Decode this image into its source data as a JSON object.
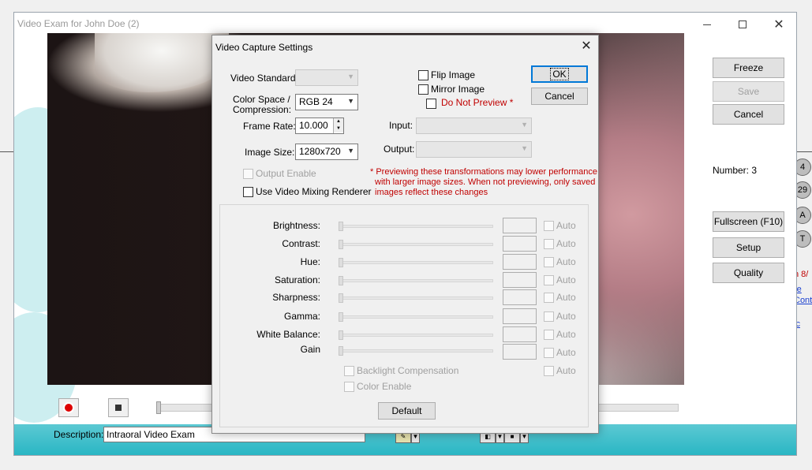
{
  "main_window": {
    "title": "Video Exam for John Doe (2)",
    "buttons": {
      "freeze": "Freeze",
      "save": "Save",
      "cancel": "Cancel",
      "fullscreen": "Fullscreen (F10)",
      "setup": "Setup",
      "quality": "Quality"
    },
    "number_label": "Number: 3",
    "description_label": "Description:",
    "description_value": "Intraoral Video Exam"
  },
  "background_side": {
    "circles": [
      "4",
      "29",
      "A",
      "T"
    ],
    "texts": [
      "n 8/",
      "re",
      "Cont",
      "ic"
    ]
  },
  "dialog": {
    "title": "Video Capture Settings",
    "video_standard_label": "Video Standard:",
    "color_space_label_1": "Color Space /",
    "color_space_label_2": "Compression:",
    "color_space_value": "RGB 24",
    "frame_rate_label": "Frame Rate:",
    "frame_rate_value": "10.000",
    "image_size_label": "Image Size:",
    "image_size_value": "1280x720",
    "output_enable": "Output Enable",
    "use_vmr": "Use Video Mixing Renderer",
    "flip_image": "Flip Image",
    "mirror_image": "Mirror Image",
    "do_not_preview": "Do Not Preview *",
    "input_label": "Input:",
    "output_label": "Output:",
    "note_line1": "* Previewing these transformations may lower performance",
    "note_line2": "with larger image sizes. When not previewing, only saved",
    "note_line3": "images reflect these changes",
    "ok": "OK",
    "cancel": "Cancel",
    "default": "Default",
    "sliders": [
      {
        "label": "Brightness:",
        "auto": "Auto"
      },
      {
        "label": "Contrast:",
        "auto": "Auto"
      },
      {
        "label": "Hue:",
        "auto": "Auto"
      },
      {
        "label": "Saturation:",
        "auto": "Auto"
      },
      {
        "label": "Sharpness:",
        "auto": "Auto"
      },
      {
        "label": "Gamma:",
        "auto": "Auto"
      },
      {
        "label": "White Balance:",
        "auto": "Auto"
      },
      {
        "label": "Gain",
        "auto": "Auto"
      }
    ],
    "backlight": "Backlight Compensation",
    "backlight_auto": "Auto",
    "color_enable": "Color Enable"
  }
}
